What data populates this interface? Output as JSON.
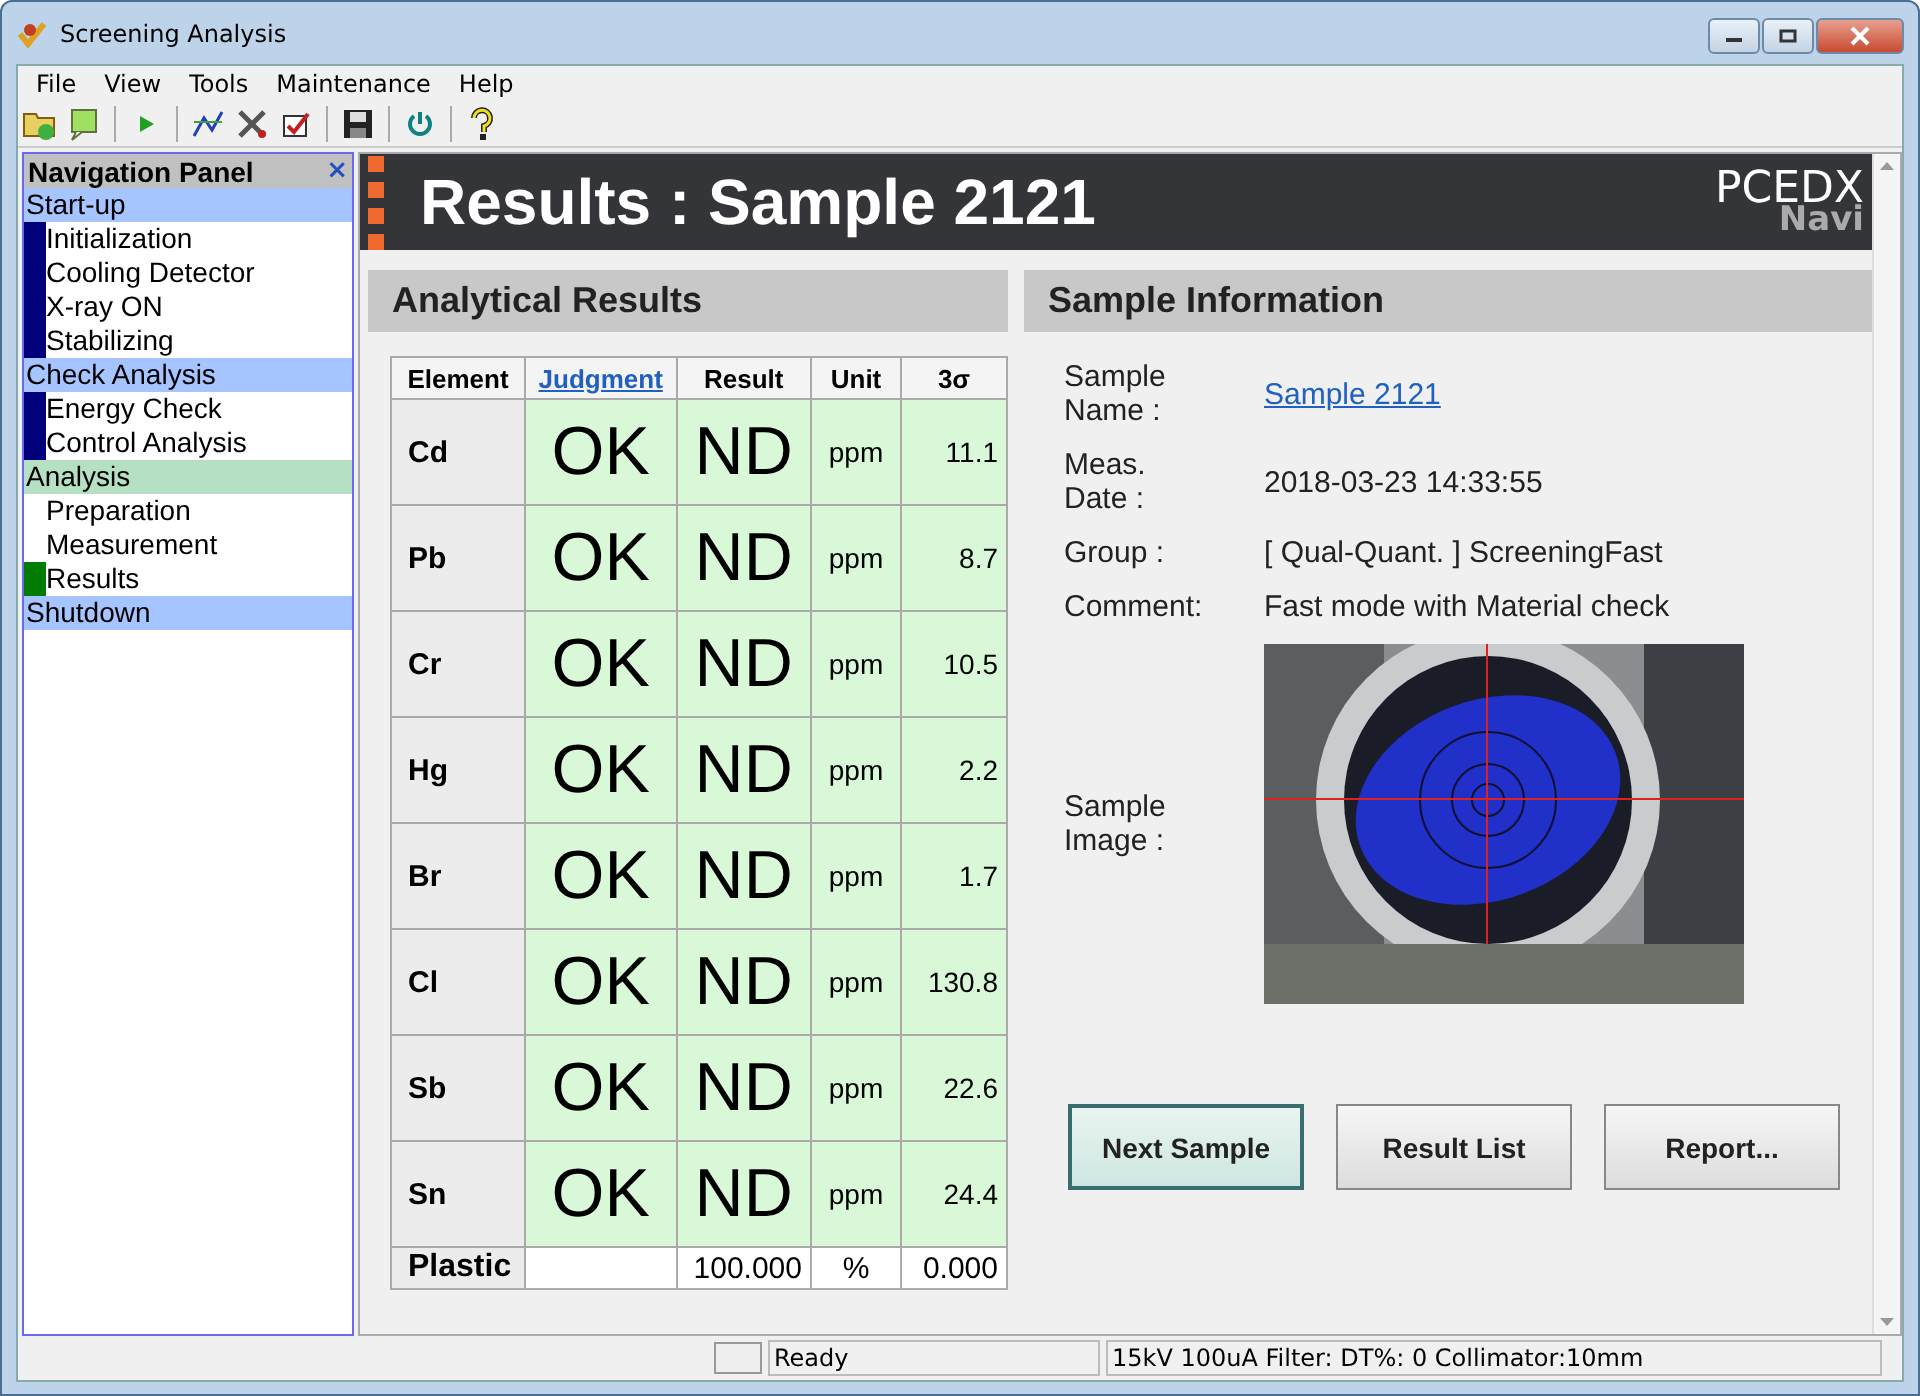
{
  "window": {
    "title": "Screening Analysis"
  },
  "menu": [
    "File",
    "View",
    "Tools",
    "Maintenance",
    "Help"
  ],
  "navigation_panel": {
    "title": "Navigation Panel",
    "close": "×",
    "sections": [
      {
        "label": "Start-up",
        "current": false,
        "items": [
          {
            "label": "Initialization",
            "done": true,
            "current": false
          },
          {
            "label": "Cooling Detector",
            "done": true,
            "current": false
          },
          {
            "label": "X-ray ON",
            "done": true,
            "current": false
          },
          {
            "label": "Stabilizing",
            "done": true,
            "current": false
          }
        ]
      },
      {
        "label": "Check Analysis",
        "current": false,
        "items": [
          {
            "label": "Energy Check",
            "done": true,
            "current": false
          },
          {
            "label": "Control Analysis",
            "done": true,
            "current": false
          }
        ]
      },
      {
        "label": "Analysis",
        "current": true,
        "items": [
          {
            "label": "Preparation",
            "done": false,
            "current": false
          },
          {
            "label": "Measurement",
            "done": false,
            "current": false
          },
          {
            "label": "Results",
            "current": true
          }
        ]
      },
      {
        "label": "Shutdown",
        "current": false
      }
    ]
  },
  "header": {
    "title": "Results : Sample 2121",
    "logo": "PCEDX",
    "logo_sub": "Navi"
  },
  "analytical_results": {
    "title": "Analytical Results",
    "columns": [
      "Element",
      "Judgment",
      "Result",
      "Unit",
      "3σ"
    ],
    "rows": [
      {
        "element": "Cd",
        "judgment": "OK",
        "result": "ND",
        "unit": "ppm",
        "sigma": "11.1"
      },
      {
        "element": "Pb",
        "judgment": "OK",
        "result": "ND",
        "unit": "ppm",
        "sigma": "8.7"
      },
      {
        "element": "Cr",
        "judgment": "OK",
        "result": "ND",
        "unit": "ppm",
        "sigma": "10.5"
      },
      {
        "element": "Hg",
        "judgment": "OK",
        "result": "ND",
        "unit": "ppm",
        "sigma": "2.2"
      },
      {
        "element": "Br",
        "judgment": "OK",
        "result": "ND",
        "unit": "ppm",
        "sigma": "1.7"
      },
      {
        "element": "Cl",
        "judgment": "OK",
        "result": "ND",
        "unit": "ppm",
        "sigma": "130.8"
      },
      {
        "element": "Sb",
        "judgment": "OK",
        "result": "ND",
        "unit": "ppm",
        "sigma": "22.6"
      },
      {
        "element": "Sn",
        "judgment": "OK",
        "result": "ND",
        "unit": "ppm",
        "sigma": "24.4"
      }
    ],
    "footer": {
      "element": "Plastic",
      "result": "100.000",
      "unit": "%",
      "sigma": "0.000"
    }
  },
  "sample_information": {
    "title": "Sample Information",
    "fields": [
      {
        "label": "Sample Name :",
        "value": "Sample 2121",
        "kind": "link"
      },
      {
        "label": "Meas. Date :",
        "value": "2018-03-23 14:33:55",
        "kind": "text"
      },
      {
        "label": "Group :",
        "value": "[ Qual-Quant. ] ScreeningFast",
        "kind": "text"
      },
      {
        "label": "Comment:",
        "value": "Fast mode with Material check",
        "kind": "text"
      },
      {
        "label": "Sample Image :",
        "kind": "picture"
      }
    ]
  },
  "buttons": [
    {
      "label": "Next Sample",
      "default": true
    },
    {
      "label": "Result List",
      "default": false
    },
    {
      "label": "Report...",
      "default": false
    }
  ],
  "status_bar": {
    "message": "Ready",
    "info": "15kV  100uA  Filter: DT%: 0 Collimator:10mm"
  }
}
